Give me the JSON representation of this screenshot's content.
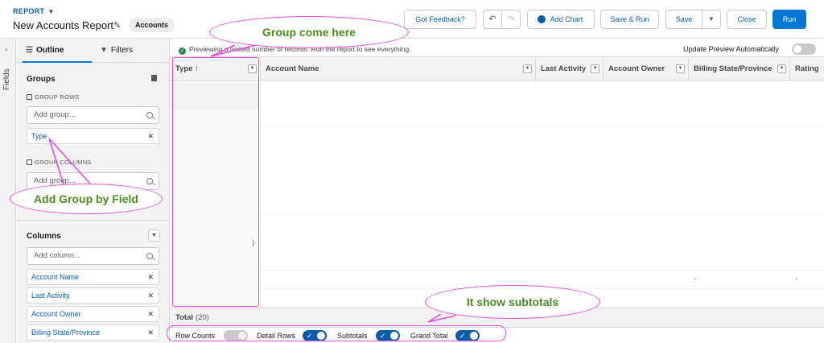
{
  "header": {
    "breadcrumb": "REPORT",
    "title": "New Accounts Report",
    "object_badge": "Accounts",
    "buttons": {
      "feedback": "Got Feedback?",
      "add_chart": "Add Chart",
      "save_run": "Save & Run",
      "save": "Save",
      "close": "Close",
      "run": "Run"
    }
  },
  "rail": {
    "label": "Fields"
  },
  "panel": {
    "tabs": {
      "outline": "Outline",
      "filters": "Filters"
    },
    "groups": {
      "title": "Groups",
      "group_rows_label": "GROUP ROWS",
      "group_rows_placeholder": "Add group...",
      "group_rows_items": [
        "Type"
      ],
      "group_columns_label": "GROUP COLUMNS",
      "group_columns_placeholder": "Add group..."
    },
    "columns": {
      "title": "Columns",
      "placeholder": "Add column...",
      "items": [
        "Account Name",
        "Last Activity",
        "Account Owner",
        "Billing State/Province"
      ]
    }
  },
  "main": {
    "notice": "Previewing a limited number of records. Run the report to see everything.",
    "auto_preview_label": "Update Preview Automatically",
    "columns": [
      {
        "label": "Type ↑"
      },
      {
        "label": "Account Name"
      },
      {
        "label": "Last Activity"
      },
      {
        "label": "Account Owner"
      },
      {
        "label": "Billing State/Province"
      },
      {
        "label": "Rating"
      }
    ],
    "paren_text": ")",
    "dash": "-",
    "total_label": "Total",
    "total_count": "(20)",
    "footer": {
      "row_counts": "Row Counts",
      "detail_rows": "Detail Rows",
      "subtotals": "Subtotals",
      "grand_total": "Grand Total"
    }
  },
  "annotations": {
    "group_here": "Group come here",
    "add_group": "Add Group by Field",
    "subtotals": "It show subtotals"
  },
  "colors": {
    "accent": "#0176d3",
    "annotation": "#e54cd8",
    "annotation_text": "#4d8a22"
  }
}
